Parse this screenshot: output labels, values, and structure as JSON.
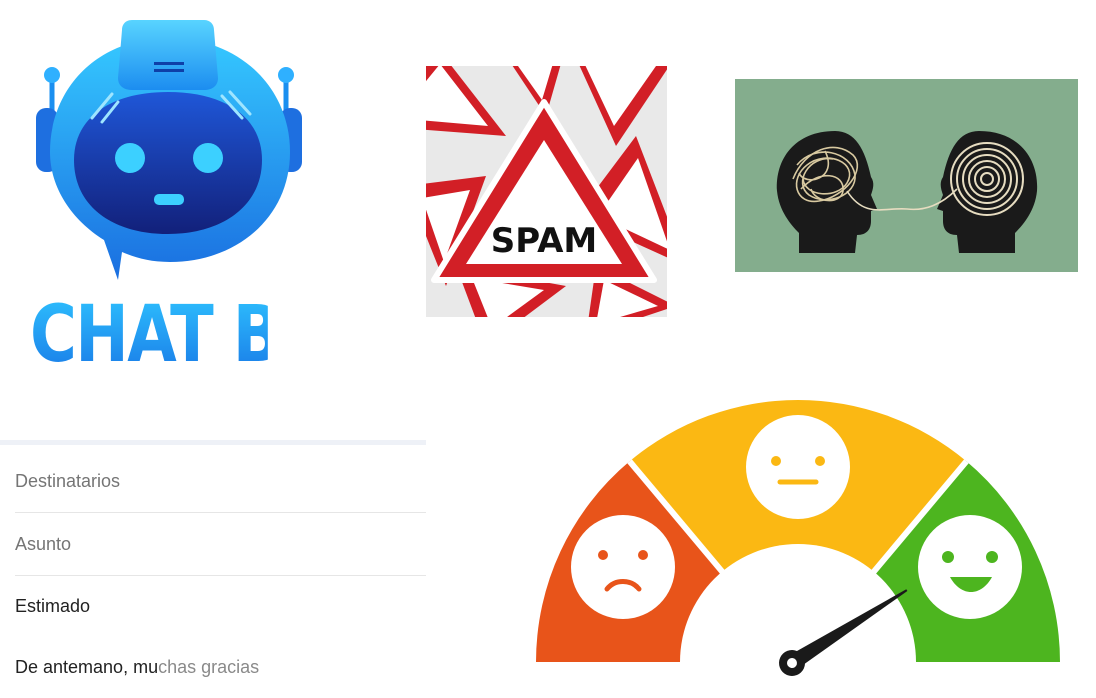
{
  "chatbot_logo": {
    "title": "CHAT BOT",
    "icon": "robot-icon",
    "colors": {
      "light": "#2fc3ff",
      "dark": "#1758d6",
      "navy": "#12207a"
    }
  },
  "spam_image": {
    "center_sign_text": "SPAM",
    "colors": {
      "red": "#d21f26",
      "white": "#ffffff",
      "black": "#111111"
    }
  },
  "communication_image": {
    "icon": "two-heads-icon",
    "colors": {
      "background": "#84ad8d",
      "heads": "#1a1a1a"
    }
  },
  "email_form": {
    "recipients_placeholder": "Destinatarios",
    "subject_placeholder": "Asunto",
    "greeting": "Estimado",
    "closing_typed": "De antemano, mu",
    "closing_suggestion": "chas gracias"
  },
  "satisfaction_gauge": {
    "icon": "satisfaction-meter-icon",
    "levels": [
      "sad",
      "neutral",
      "happy"
    ],
    "needle_level": 0.82,
    "colors": {
      "sad": "#e8541a",
      "neutral": "#fbb813",
      "happy": "#4db51f",
      "needle": "#1a1a1a"
    }
  }
}
